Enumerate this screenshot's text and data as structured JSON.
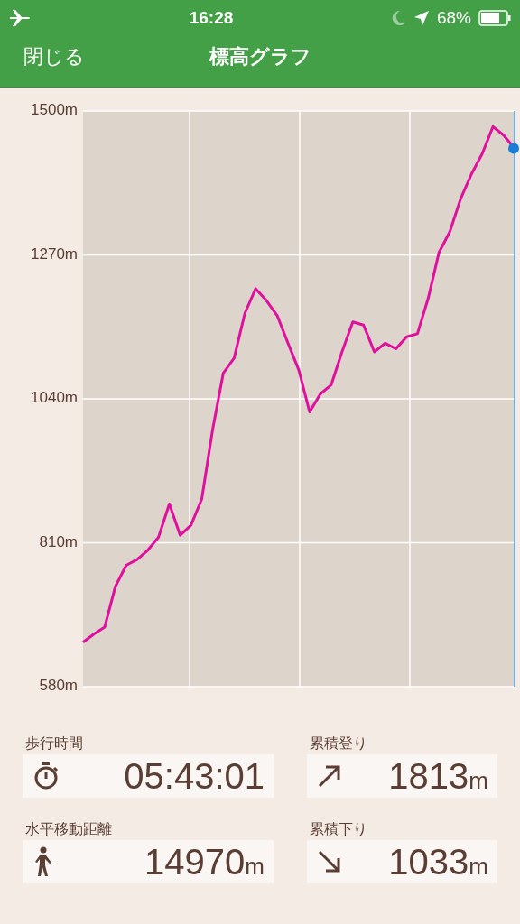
{
  "status_bar": {
    "time": "16:28",
    "battery": "68%"
  },
  "nav": {
    "close": "閉じる",
    "title": "標高グラフ"
  },
  "chart": {
    "chart_data": {
      "type": "line",
      "grid": true,
      "series": [
        {
          "color": "#e0109f",
          "values": [
            651,
            664,
            675,
            740,
            774,
            783,
            798,
            819,
            872,
            822,
            838,
            880,
            990,
            1081,
            1105,
            1177,
            1216,
            1197,
            1173,
            1129,
            1086,
            1019,
            1048,
            1062,
            1115,
            1163,
            1158,
            1115,
            1129,
            1120,
            1139,
            1144,
            1201,
            1274,
            1307,
            1360,
            1399,
            1432,
            1475,
            1461,
            1440
          ]
        }
      ],
      "ylim": [
        580,
        1500
      ],
      "yticks": [
        {
          "value": 580,
          "label": "580m"
        },
        {
          "value": 810,
          "label": "810m"
        },
        {
          "value": 1040,
          "label": "1040m"
        },
        {
          "value": 1270,
          "label": "1270m"
        },
        {
          "value": 1500,
          "label": "1500m"
        }
      ]
    }
  },
  "stats": [
    {
      "kind": "timer",
      "label": "歩行時間",
      "value": "05:43:01"
    },
    {
      "kind": "up",
      "label": "累積登り",
      "value": "1813",
      "unit": "m"
    },
    {
      "kind": "walk",
      "label": "水平移動距離",
      "value": "14970",
      "unit": "m"
    },
    {
      "kind": "down",
      "label": "累積下り",
      "value": "1033",
      "unit": "m"
    }
  ]
}
